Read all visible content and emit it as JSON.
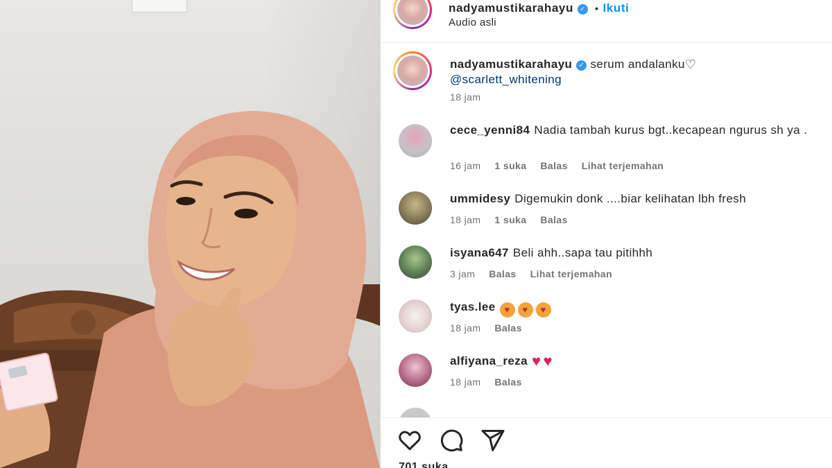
{
  "post": {
    "owner": "nadyamustikarahayu",
    "follow_label": "Ikuti",
    "audio": "Audio asli",
    "caption_user": "nadyamustikarahayu",
    "caption_text": "serum andalanku",
    "caption_mention": "@scarlett_whitening",
    "caption_time": "18 jam",
    "likes": "701 suka"
  },
  "comments": [
    {
      "user": "cece_yenni84",
      "text": "Nadia tambah kurus bgt..kecapean ngurus sh ya .",
      "time": "16 jam",
      "likes": "1 suka",
      "reply": "Balas",
      "translate": "Lihat terjemahan"
    },
    {
      "user": "ummidesy",
      "text": "Digemukin donk ....biar kelihatan lbh fresh",
      "time": "18 jam",
      "likes": "1 suka",
      "reply": "Balas"
    },
    {
      "user": "isyana647",
      "text": "Beli ahh..sapa tau pitihhh",
      "time": "3 jam",
      "reply": "Balas",
      "translate": "Lihat terjemahan"
    },
    {
      "user": "tyas.lee",
      "text": "",
      "time": "18 jam",
      "reply": "Balas",
      "emojis": [
        "heart-eyes-emoji",
        "heart-eyes-emoji",
        "heart-eyes-emoji"
      ]
    },
    {
      "user": "alfiyana_reza",
      "text": "",
      "time": "18 jam",
      "reply": "Balas",
      "emojis": [
        "red-heart-emoji",
        "red-heart-emoji"
      ]
    }
  ],
  "icons": {
    "like": "heart-outline-icon",
    "comment": "speech-bubble-icon",
    "share": "paper-plane-icon",
    "verified": "verified-badge-icon"
  },
  "colors": {
    "link_blue": "#0095f6",
    "verified_blue": "#3897f0",
    "muted_text": "#737373",
    "hijab": "#e3ab94"
  }
}
